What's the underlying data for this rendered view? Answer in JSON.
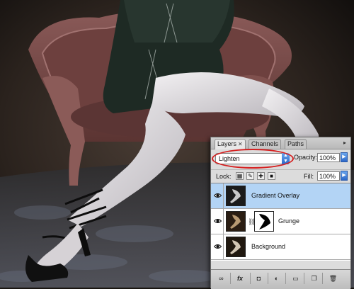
{
  "layers_panel": {
    "tabs": [
      {
        "label": "Layers",
        "close": "✕"
      },
      {
        "label": "Channels"
      },
      {
        "label": "Paths"
      }
    ],
    "blend_mode": "Lighten",
    "opacity_label": "Opacity:",
    "opacity_value": "100%",
    "lock_label": "Lock:",
    "fill_label": "Fill:",
    "fill_value": "100%",
    "layers": [
      {
        "name": "Gradient Overlay",
        "selected": true,
        "visible": true
      },
      {
        "name": "Grunge",
        "selected": false,
        "visible": true,
        "has_mask": true
      },
      {
        "name": "Background",
        "selected": false,
        "visible": true
      }
    ],
    "bottom_buttons": [
      "link-layers-icon",
      "fx-icon",
      "add-mask-icon",
      "adjustment-layer-icon",
      "new-group-icon",
      "new-layer-icon",
      "trash-icon"
    ],
    "fx_label": "fx"
  },
  "colors": {
    "selected_row": "#b3d4f5",
    "highlight_ellipse": "#d62020",
    "stepper_blue": "#2d68c8"
  }
}
